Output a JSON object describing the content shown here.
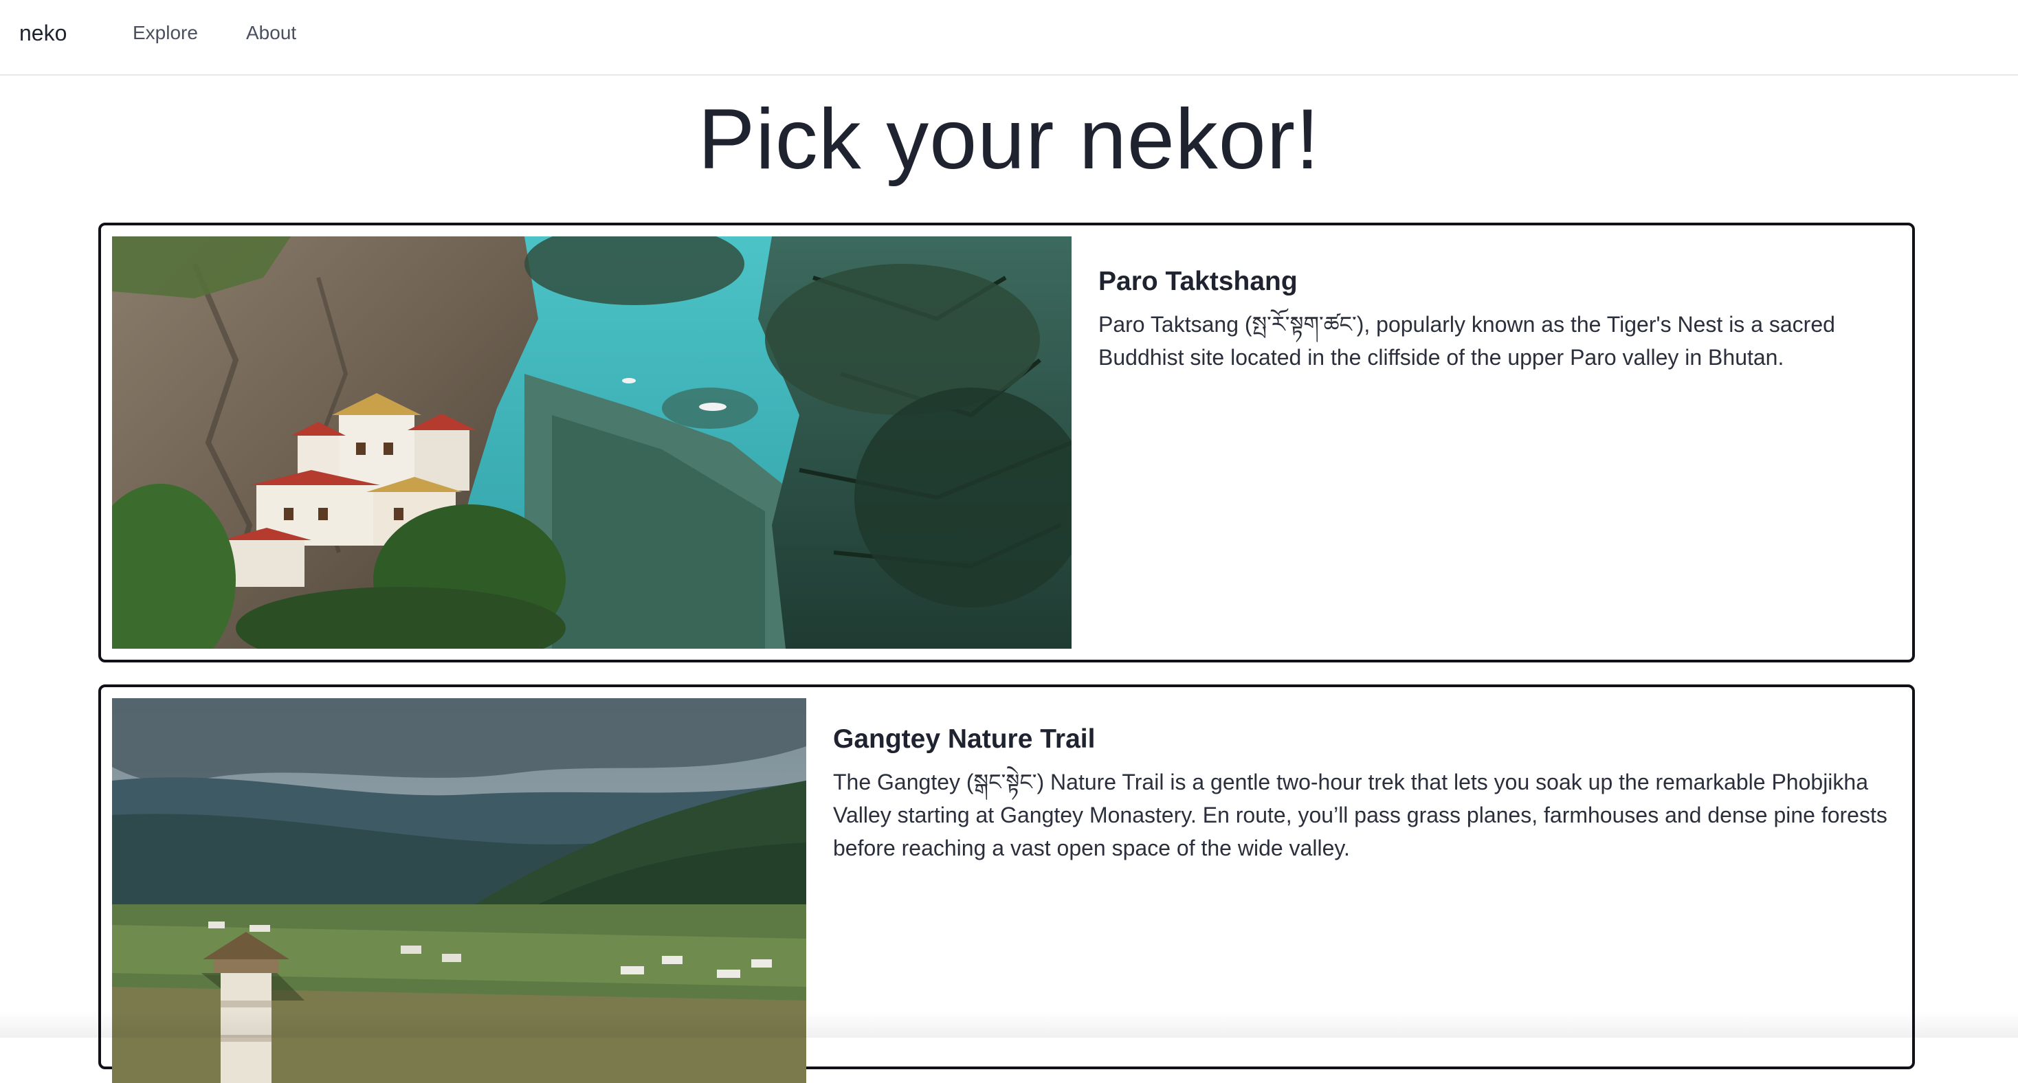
{
  "nav": {
    "brand": "neko",
    "links": [
      "Explore",
      "About"
    ]
  },
  "page": {
    "title": "Pick your nekor!"
  },
  "cards": [
    {
      "title": "Paro Taktshang",
      "description": "Paro Taktsang (སྤ་རོ་སྟག་ཚང་), popularly known as the Tiger's Nest is a sacred Buddhist site located in the cliffside of the upper Paro valley in Bhutan.",
      "image_icon": "monastery-cliff-photo"
    },
    {
      "title": "Gangtey Nature Trail",
      "description": "The Gangtey (སྒང་སྟེང་) Nature Trail is a gentle two-hour trek that lets you soak up the remarkable Phobjikha Valley starting at Gangtey Monastery. En route, you’ll pass grass planes, farmhouses and dense pine forests before reaching a vast open space of the wide valley.",
      "image_icon": "valley-landscape-photo"
    }
  ],
  "colors": {
    "text": "#1f2330",
    "card_border": "#101218",
    "navbar_border": "#e7e8ec"
  }
}
